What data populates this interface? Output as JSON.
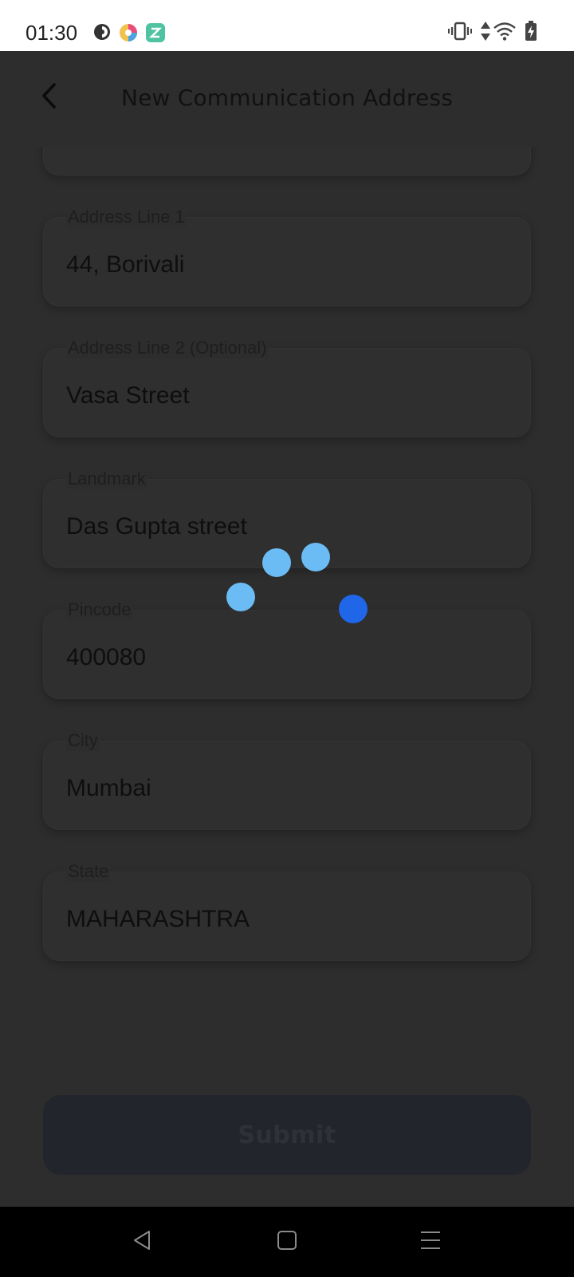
{
  "status_bar": {
    "time": "01:30",
    "left_icons": [
      "data-saver-icon",
      "color-app-icon",
      "green-app-icon"
    ],
    "right_icons": [
      "vibrate-icon",
      "data-arrows-icon",
      "wifi-icon",
      "battery-charging-icon"
    ]
  },
  "header": {
    "title": "New Communication Address",
    "back_icon": "back-arrow-icon"
  },
  "form": {
    "fields": [
      {
        "label": "Address Line 1",
        "value": "44, Borivali"
      },
      {
        "label": "Address Line 2 (Optional)",
        "value": "Vasa Street"
      },
      {
        "label": "Landmark",
        "value": "Das Gupta street"
      },
      {
        "label": "Pincode",
        "value": "400080"
      },
      {
        "label": "City",
        "value": "Mumbai"
      },
      {
        "label": "State",
        "value": "MAHARASHTRA"
      }
    ],
    "submit_label": "Submit"
  },
  "loader": {
    "dot_colors": [
      "#6bbcf5",
      "#6bbcf5",
      "#6bbcf5",
      "#1f66e8"
    ]
  },
  "nav_bar": {
    "icons": [
      "nav-back-icon",
      "nav-home-icon",
      "nav-menu-icon"
    ]
  }
}
